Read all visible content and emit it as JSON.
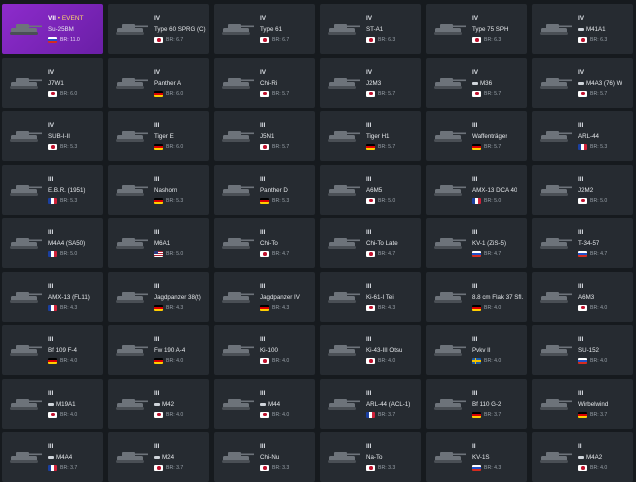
{
  "colors": {
    "background": "#161a1e",
    "card": "#262b31",
    "selected_card": "#8d2bcc",
    "event_label": "#ffd86b"
  },
  "vehicles": [
    {
      "tier": "VII",
      "event": "• EVENT",
      "name": "Su-25BM",
      "prefix_icon": false,
      "nation": "russia",
      "br": "BR: 11.0",
      "selected": true
    },
    {
      "tier": "IV",
      "event": "",
      "name": "Type 60 SPRG (C)",
      "prefix_icon": false,
      "nation": "japan",
      "br": "BR: 6.7",
      "selected": false
    },
    {
      "tier": "IV",
      "event": "",
      "name": "Type 61",
      "prefix_icon": false,
      "nation": "japan",
      "br": "BR: 6.7",
      "selected": false
    },
    {
      "tier": "IV",
      "event": "",
      "name": "ST-A1",
      "prefix_icon": false,
      "nation": "japan",
      "br": "BR: 6.3",
      "selected": false
    },
    {
      "tier": "IV",
      "event": "",
      "name": "Type 75 SPH",
      "prefix_icon": false,
      "nation": "japan",
      "br": "BR: 6.3",
      "selected": false
    },
    {
      "tier": "IV",
      "event": "",
      "name": "M41A1",
      "prefix_icon": true,
      "nation": "japan",
      "br": "BR: 6.3",
      "selected": false
    },
    {
      "tier": "IV",
      "event": "",
      "name": "J7W1",
      "prefix_icon": false,
      "nation": "japan",
      "br": "BR: 6.0",
      "selected": false
    },
    {
      "tier": "IV",
      "event": "",
      "name": "Panther A",
      "prefix_icon": false,
      "nation": "germany",
      "br": "BR: 6.0",
      "selected": false
    },
    {
      "tier": "IV",
      "event": "",
      "name": "Chi-Ri",
      "prefix_icon": false,
      "nation": "japan",
      "br": "BR: 5.7",
      "selected": false
    },
    {
      "tier": "IV",
      "event": "",
      "name": "J2M3",
      "prefix_icon": false,
      "nation": "japan",
      "br": "BR: 5.7",
      "selected": false
    },
    {
      "tier": "IV",
      "event": "",
      "name": "M36",
      "prefix_icon": true,
      "nation": "japan",
      "br": "BR: 5.7",
      "selected": false
    },
    {
      "tier": "IV",
      "event": "",
      "name": "M4A3 (76) W",
      "prefix_icon": true,
      "nation": "japan",
      "br": "BR: 5.7",
      "selected": false
    },
    {
      "tier": "IV",
      "event": "",
      "name": "SUB-I-II",
      "prefix_icon": false,
      "nation": "japan",
      "br": "BR: 5.3",
      "selected": false
    },
    {
      "tier": "III",
      "event": "",
      "name": "Tiger E",
      "prefix_icon": false,
      "nation": "germany",
      "br": "BR: 6.0",
      "selected": false
    },
    {
      "tier": "III",
      "event": "",
      "name": "J5N1",
      "prefix_icon": false,
      "nation": "japan",
      "br": "BR: 5.7",
      "selected": false
    },
    {
      "tier": "III",
      "event": "",
      "name": "Tiger H1",
      "prefix_icon": false,
      "nation": "germany",
      "br": "BR: 5.7",
      "selected": false
    },
    {
      "tier": "III",
      "event": "",
      "name": "Waffenträger",
      "prefix_icon": false,
      "nation": "germany",
      "br": "BR: 5.7",
      "selected": false
    },
    {
      "tier": "III",
      "event": "",
      "name": "ARL-44",
      "prefix_icon": false,
      "nation": "france",
      "br": "BR: 5.3",
      "selected": false
    },
    {
      "tier": "III",
      "event": "",
      "name": "E.B.R. (1951)",
      "prefix_icon": false,
      "nation": "france",
      "br": "BR: 5.3",
      "selected": false
    },
    {
      "tier": "III",
      "event": "",
      "name": "Nashorn",
      "prefix_icon": false,
      "nation": "germany",
      "br": "BR: 5.3",
      "selected": false
    },
    {
      "tier": "III",
      "event": "",
      "name": "Panther D",
      "prefix_icon": false,
      "nation": "germany",
      "br": "BR: 5.3",
      "selected": false
    },
    {
      "tier": "III",
      "event": "",
      "name": "A6M5",
      "prefix_icon": false,
      "nation": "japan",
      "br": "BR: 5.0",
      "selected": false
    },
    {
      "tier": "III",
      "event": "",
      "name": "AMX-13 DCA 40",
      "prefix_icon": false,
      "nation": "france",
      "br": "BR: 5.0",
      "selected": false
    },
    {
      "tier": "III",
      "event": "",
      "name": "J2M2",
      "prefix_icon": false,
      "nation": "japan",
      "br": "BR: 5.0",
      "selected": false
    },
    {
      "tier": "III",
      "event": "",
      "name": "M4A4 (SA50)",
      "prefix_icon": false,
      "nation": "france",
      "br": "BR: 5.0",
      "selected": false
    },
    {
      "tier": "III",
      "event": "",
      "name": "M6A1",
      "prefix_icon": false,
      "nation": "usa",
      "br": "BR: 5.0",
      "selected": false
    },
    {
      "tier": "III",
      "event": "",
      "name": "Chi-To",
      "prefix_icon": false,
      "nation": "japan",
      "br": "BR: 4.7",
      "selected": false
    },
    {
      "tier": "III",
      "event": "",
      "name": "Chi-To Late",
      "prefix_icon": false,
      "nation": "japan",
      "br": "BR: 4.7",
      "selected": false
    },
    {
      "tier": "III",
      "event": "",
      "name": "KV-1 (ZiS-5)",
      "prefix_icon": false,
      "nation": "russia",
      "br": "BR: 4.7",
      "selected": false
    },
    {
      "tier": "III",
      "event": "",
      "name": "T-34-57",
      "prefix_icon": false,
      "nation": "russia",
      "br": "BR: 4.7",
      "selected": false
    },
    {
      "tier": "III",
      "event": "",
      "name": "AMX-13 (FL11)",
      "prefix_icon": false,
      "nation": "france",
      "br": "BR: 4.3",
      "selected": false
    },
    {
      "tier": "III",
      "event": "",
      "name": "Jagdpanzer 38(t)",
      "prefix_icon": false,
      "nation": "germany",
      "br": "BR: 4.3",
      "selected": false
    },
    {
      "tier": "III",
      "event": "",
      "name": "Jagdpanzer IV",
      "prefix_icon": false,
      "nation": "germany",
      "br": "BR: 4.3",
      "selected": false
    },
    {
      "tier": "III",
      "event": "",
      "name": "Ki-61-I Tei",
      "prefix_icon": false,
      "nation": "japan",
      "br": "BR: 4.3",
      "selected": false
    },
    {
      "tier": "III",
      "event": "",
      "name": "8.8 cm Flak 37 Sfl.",
      "prefix_icon": false,
      "nation": "germany",
      "br": "BR: 4.0",
      "selected": false
    },
    {
      "tier": "III",
      "event": "",
      "name": "A6M3",
      "prefix_icon": false,
      "nation": "japan",
      "br": "BR: 4.0",
      "selected": false
    },
    {
      "tier": "III",
      "event": "",
      "name": "Bf 109 F-4",
      "prefix_icon": false,
      "nation": "germany",
      "br": "BR: 4.0",
      "selected": false
    },
    {
      "tier": "III",
      "event": "",
      "name": "Fw 190 A-4",
      "prefix_icon": false,
      "nation": "germany",
      "br": "BR: 4.0",
      "selected": false
    },
    {
      "tier": "III",
      "event": "",
      "name": "Ki-100",
      "prefix_icon": false,
      "nation": "japan",
      "br": "BR: 4.0",
      "selected": false
    },
    {
      "tier": "III",
      "event": "",
      "name": "Ki-43-III Otsu",
      "prefix_icon": false,
      "nation": "japan",
      "br": "BR: 4.0",
      "selected": false
    },
    {
      "tier": "III",
      "event": "",
      "name": "Pvkv II",
      "prefix_icon": false,
      "nation": "sweden",
      "br": "BR: 4.0",
      "selected": false
    },
    {
      "tier": "III",
      "event": "",
      "name": "SU-152",
      "prefix_icon": false,
      "nation": "russia",
      "br": "BR: 4.0",
      "selected": false
    },
    {
      "tier": "III",
      "event": "",
      "name": "M19A1",
      "prefix_icon": true,
      "nation": "japan",
      "br": "BR: 4.0",
      "selected": false
    },
    {
      "tier": "III",
      "event": "",
      "name": "M42",
      "prefix_icon": true,
      "nation": "japan",
      "br": "BR: 4.0",
      "selected": false
    },
    {
      "tier": "III",
      "event": "",
      "name": "M44",
      "prefix_icon": true,
      "nation": "japan",
      "br": "BR: 4.0",
      "selected": false
    },
    {
      "tier": "III",
      "event": "",
      "name": "ARL-44 (ACL-1)",
      "prefix_icon": false,
      "nation": "france",
      "br": "BR: 3.7",
      "selected": false
    },
    {
      "tier": "III",
      "event": "",
      "name": "Bf 110 G-2",
      "prefix_icon": false,
      "nation": "germany",
      "br": "BR: 3.7",
      "selected": false
    },
    {
      "tier": "III",
      "event": "",
      "name": "Wirbelwind",
      "prefix_icon": false,
      "nation": "germany",
      "br": "BR: 3.7",
      "selected": false
    },
    {
      "tier": "III",
      "event": "",
      "name": "M4A4",
      "prefix_icon": true,
      "nation": "france",
      "br": "BR: 3.7",
      "selected": false
    },
    {
      "tier": "III",
      "event": "",
      "name": "M24",
      "prefix_icon": true,
      "nation": "japan",
      "br": "BR: 3.7",
      "selected": false
    },
    {
      "tier": "III",
      "event": "",
      "name": "Chi-Nu",
      "prefix_icon": false,
      "nation": "japan",
      "br": "BR: 3.3",
      "selected": false
    },
    {
      "tier": "III",
      "event": "",
      "name": "Na-To",
      "prefix_icon": false,
      "nation": "japan",
      "br": "BR: 3.3",
      "selected": false
    },
    {
      "tier": "II",
      "event": "",
      "name": "KV-1S",
      "prefix_icon": false,
      "nation": "russia",
      "br": "BR: 4.3",
      "selected": false
    },
    {
      "tier": "II",
      "event": "",
      "name": "M4A2",
      "prefix_icon": true,
      "nation": "japan",
      "br": "BR: 4.0",
      "selected": false
    }
  ]
}
